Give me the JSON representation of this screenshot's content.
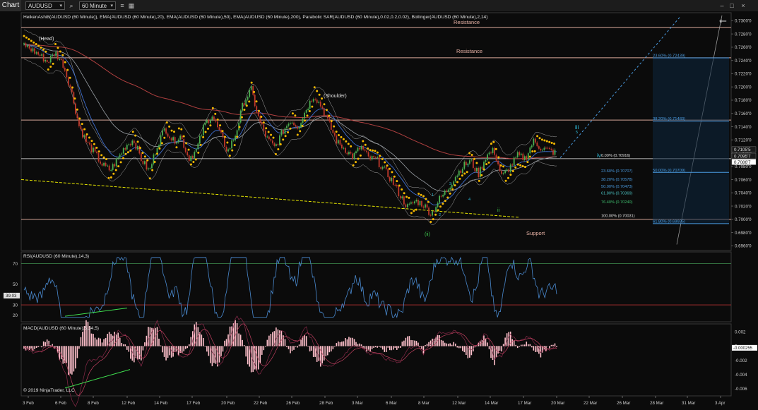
{
  "toolbar": {
    "tab_label": "Chart",
    "instrument": "AUDUSD",
    "interval": "60 Minute"
  },
  "indicator_header": "HeikenAshi8(AUDUSD (60 Minute)), EMA(AUDUSD (60 Minute),20), EMA(AUDUSD (60 Minute),50), EMA(AUDUSD (60 Minute),200), Parabolic SAR(AUDUSD (60 Minute),0.02,0.2,0.02), Bollinger(AUDUSD (60 Minute),2,14)",
  "copyright": "© 2019 NinjaTrader, LLC",
  "colors": {
    "background": "#0b0b0b",
    "candle_up": "#4caf50",
    "candle_down": "#c0392b",
    "sar_dots": "#f5b800",
    "ema20": "#3f6fd0",
    "ema50": "#9aa0a6",
    "ema200": "#b04040",
    "resistance_line": "#d9a89a",
    "support_trend": "#e6e600",
    "fib_blue": "#4a9be0",
    "rsi_line": "#4a8ad0",
    "macd_hist": "#ffc0cb"
  },
  "chart_data": [
    {
      "type": "line",
      "panel": "price",
      "y_ticks": [
        "0.7300'0",
        "0.7280'0",
        "0.7260'0",
        "0.7240'0",
        "0.7220'0",
        "0.7200'0",
        "0.7180'0",
        "0.7160'0",
        "0.7140'0",
        "0.7120'0",
        "0.7100'0",
        "0.7080'0",
        "0.7060'0",
        "0.7040'0",
        "0.7020'0",
        "0.7000'0",
        "0.6980'0",
        "0.6960'0"
      ],
      "ylim": [
        0.6955,
        0.731
      ],
      "x_ticks": [
        "3 Feb",
        "6 Feb",
        "8 Feb",
        "12 Feb",
        "14 Feb",
        "17 Feb",
        "20 Feb",
        "22 Feb",
        "26 Feb",
        "28 Feb",
        "3 Mar",
        "6 Mar",
        "8 Mar",
        "12 Mar",
        "14 Mar",
        "17 Mar",
        "20 Mar",
        "22 Mar",
        "26 Mar",
        "28 Mar",
        "31 Mar",
        "3 Apr"
      ],
      "price_path": [
        [
          0,
          0.7264
        ],
        [
          2,
          0.7248
        ],
        [
          3,
          0.7238
        ],
        [
          4,
          0.7252
        ],
        [
          5,
          0.7234
        ],
        [
          6,
          0.7196
        ],
        [
          7,
          0.7142
        ],
        [
          8,
          0.7116
        ],
        [
          9,
          0.71
        ],
        [
          10,
          0.7082
        ],
        [
          11,
          0.7074
        ],
        [
          12,
          0.7092
        ],
        [
          13,
          0.7112
        ],
        [
          14,
          0.712
        ],
        [
          15,
          0.709
        ],
        [
          16,
          0.7072
        ],
        [
          17,
          0.7112
        ],
        [
          18,
          0.7138
        ],
        [
          19,
          0.7118
        ],
        [
          20,
          0.7126
        ],
        [
          21,
          0.7092
        ],
        [
          22,
          0.7104
        ],
        [
          23,
          0.7142
        ],
        [
          24,
          0.7158
        ],
        [
          25,
          0.713
        ],
        [
          26,
          0.7102
        ],
        [
          27,
          0.7128
        ],
        [
          28,
          0.7176
        ],
        [
          29,
          0.7196
        ],
        [
          30,
          0.715
        ],
        [
          31,
          0.7122
        ],
        [
          32,
          0.7108
        ],
        [
          33,
          0.7132
        ],
        [
          34,
          0.715
        ],
        [
          35,
          0.714
        ],
        [
          36,
          0.7166
        ],
        [
          37,
          0.7188
        ],
        [
          38,
          0.717
        ],
        [
          39,
          0.7142
        ],
        [
          40,
          0.7116
        ],
        [
          41,
          0.7106
        ],
        [
          42,
          0.7094
        ],
        [
          43,
          0.711
        ],
        [
          44,
          0.7092
        ],
        [
          45,
          0.709
        ],
        [
          46,
          0.7074
        ],
        [
          47,
          0.7058
        ],
        [
          48,
          0.7036
        ],
        [
          49,
          0.7018
        ],
        [
          50,
          0.7028
        ],
        [
          51,
          0.7022
        ],
        [
          52,
          0.7008
        ],
        [
          53,
          0.703
        ],
        [
          54,
          0.7044
        ],
        [
          55,
          0.7064
        ],
        [
          56,
          0.708
        ],
        [
          57,
          0.7088
        ],
        [
          58,
          0.7068
        ],
        [
          59,
          0.7096
        ],
        [
          60,
          0.7104
        ],
        [
          61,
          0.7064
        ],
        [
          62,
          0.7078
        ],
        [
          63,
          0.7096
        ],
        [
          64,
          0.7092
        ],
        [
          65,
          0.7118
        ],
        [
          66,
          0.7108
        ],
        [
          67,
          0.7104
        ],
        [
          68,
          0.71
        ]
      ],
      "last_price_labels": [
        "0.7105'5",
        "0.7095'7",
        "0.7086'7"
      ],
      "resistance_labels": [
        "Resistance",
        "Resistance"
      ],
      "support_label": "Support",
      "resistance_levels": [
        0.729,
        0.7244,
        0.715
      ],
      "support_level": 0.7,
      "annotations": [
        "(Head)",
        "(Shoulder)",
        "iii",
        "iv",
        "(ii)",
        "i",
        "ii",
        "1",
        "2",
        "3",
        "4",
        "5"
      ],
      "fib_left": [
        "0.00% (0.70916)",
        "23.60% (0.70707)",
        "38.20% (0.70578)",
        "50.00% (0.70473)",
        "61.80% (0.70369)",
        "76.40% (0.70240)",
        "100.00% (0.70031)"
      ],
      "fib_right": [
        "23.60% (0.72439)",
        "38.20% (0.71483)",
        "50.00% (0.70709)",
        "61.80% (0.69935)"
      ]
    },
    {
      "type": "line",
      "panel": "rsi",
      "title": "RSI(AUDUSD (60 Minute),14,3)",
      "y_ticks": [
        "70",
        "50",
        "30",
        "20"
      ],
      "ylim": [
        15,
        80
      ],
      "current_value": "39.03",
      "upper_band": 70,
      "lower_band": 30
    },
    {
      "type": "bar",
      "panel": "macd",
      "title": "MACD(AUDUSD (60 Minute),5,34,5)",
      "y_ticks": [
        "0.002",
        "0",
        "-0.002",
        "-0.004",
        "-0.006"
      ],
      "ylim": [
        -0.0068,
        0.0028
      ],
      "current_value": "-0.000255"
    }
  ]
}
